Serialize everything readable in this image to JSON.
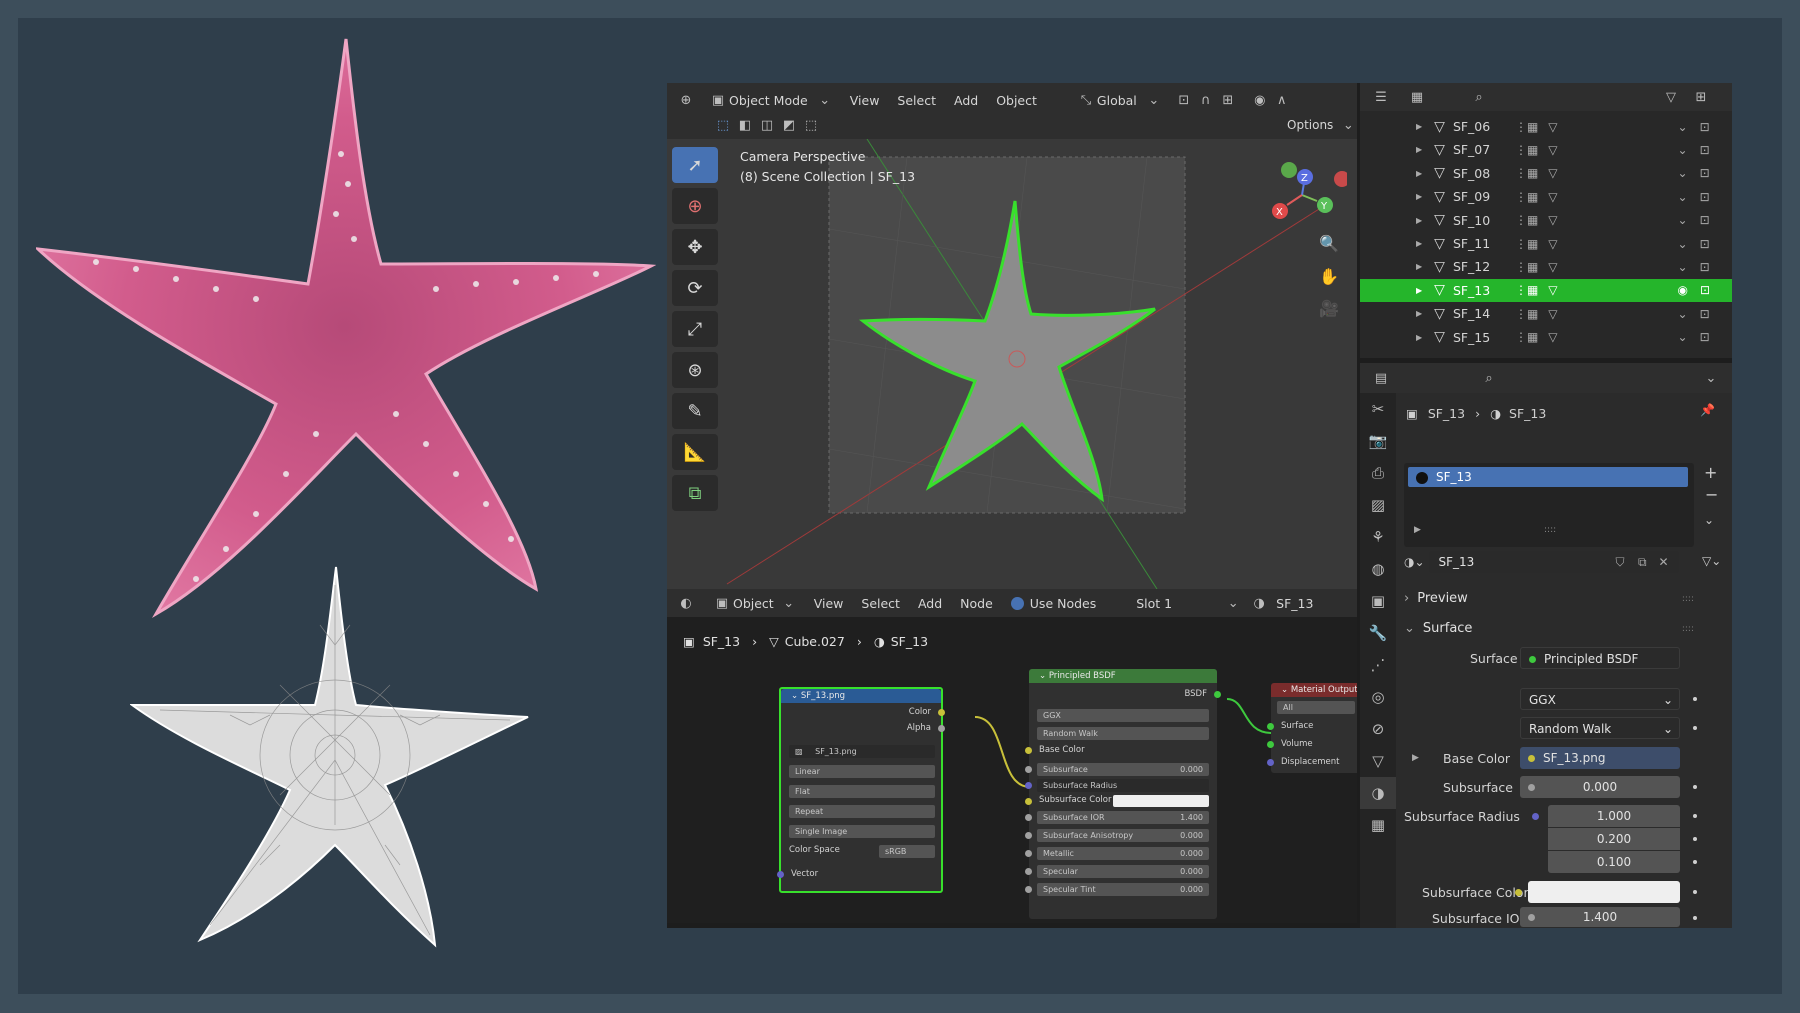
{
  "colors": {
    "accent": "#4772b3",
    "selected_row": "#25b52b",
    "selection_outline": "#38e02c",
    "texture_node_header": "#2a5b95",
    "shader_node_header": "#3c7a3a",
    "output_node_header": "#7a2c2c",
    "starfish_pink": "#d25c8c"
  },
  "header": {
    "mode": "Object Mode",
    "menu": [
      "View",
      "Select",
      "Add",
      "Object"
    ],
    "transform_orientation": "Global",
    "options": "Options"
  },
  "viewport": {
    "camera_label": "Camera Perspective",
    "collection_label": "(8) Scene Collection | SF_13",
    "gizmo": {
      "x": "X",
      "y": "Y",
      "z": "Z"
    },
    "tools": [
      "select-box",
      "cursor",
      "move",
      "rotate",
      "scale",
      "transform",
      "annotate",
      "measure",
      "add-cube"
    ]
  },
  "node_header": {
    "editor_type": "Object",
    "menu": [
      "View",
      "Select",
      "Add",
      "Node"
    ],
    "use_nodes": "Use Nodes",
    "slot": "Slot 1",
    "material": "SF_13"
  },
  "node_breadcrumb": [
    "SF_13",
    "Cube.027",
    "SF_13"
  ],
  "nodes": {
    "image": {
      "title": "SF_13.png",
      "outputs": [
        "Color",
        "Alpha"
      ],
      "image_name": "SF_13.png",
      "interpolation": "Linear",
      "projection": "Flat",
      "extension": "Repeat",
      "source": "Single Image",
      "color_space_label": "Color Space",
      "color_space": "sRGB",
      "input": "Vector"
    },
    "bsdf": {
      "title": "Principled BSDF",
      "output": "BSDF",
      "distribution": "GGX",
      "subsurface_method": "Random Walk",
      "base_color": "Base Color",
      "fields": [
        {
          "label": "Subsurface",
          "value": "0.000"
        },
        {
          "label": "Subsurface Radius",
          "value": ""
        },
        {
          "label": "Subsurface Color",
          "value": ""
        },
        {
          "label": "Subsurface IOR",
          "value": "1.400"
        },
        {
          "label": "Subsurface Anisotropy",
          "value": "0.000"
        },
        {
          "label": "Metallic",
          "value": "0.000"
        },
        {
          "label": "Specular",
          "value": "0.000"
        },
        {
          "label": "Specular Tint",
          "value": "0.000"
        }
      ]
    },
    "output": {
      "title": "Material Output",
      "target": "All",
      "inputs": [
        "Surface",
        "Volume",
        "Displacement"
      ]
    }
  },
  "outliner": {
    "rows": [
      {
        "name": "SF_06",
        "selected": false
      },
      {
        "name": "SF_07",
        "selected": false
      },
      {
        "name": "SF_08",
        "selected": false
      },
      {
        "name": "SF_09",
        "selected": false
      },
      {
        "name": "SF_10",
        "selected": false
      },
      {
        "name": "SF_11",
        "selected": false
      },
      {
        "name": "SF_12",
        "selected": false
      },
      {
        "name": "SF_13",
        "selected": true
      },
      {
        "name": "SF_14",
        "selected": false
      },
      {
        "name": "SF_15",
        "selected": false
      }
    ]
  },
  "properties": {
    "breadcrumb": [
      "SF_13",
      "SF_13"
    ],
    "material_slot": "SF_13",
    "material_name": "SF_13",
    "panels": {
      "preview": "Preview",
      "surface": "Surface"
    },
    "surface_label": "Surface",
    "surface_value": "Principled BSDF",
    "distribution": "GGX",
    "subsurface_method": "Random Walk",
    "base_color_label": "Base Color",
    "base_color_value": "SF_13.png",
    "subsurface_label": "Subsurface",
    "subsurface_value": "0.000",
    "subsurface_radius_label": "Subsurface Radius",
    "subsurface_radius": [
      "1.000",
      "0.200",
      "0.100"
    ],
    "subsurface_color_label": "Subsurface Color",
    "subsurface_ior_label": "Subsurface IOR",
    "subsurface_ior_value": "1.400"
  }
}
